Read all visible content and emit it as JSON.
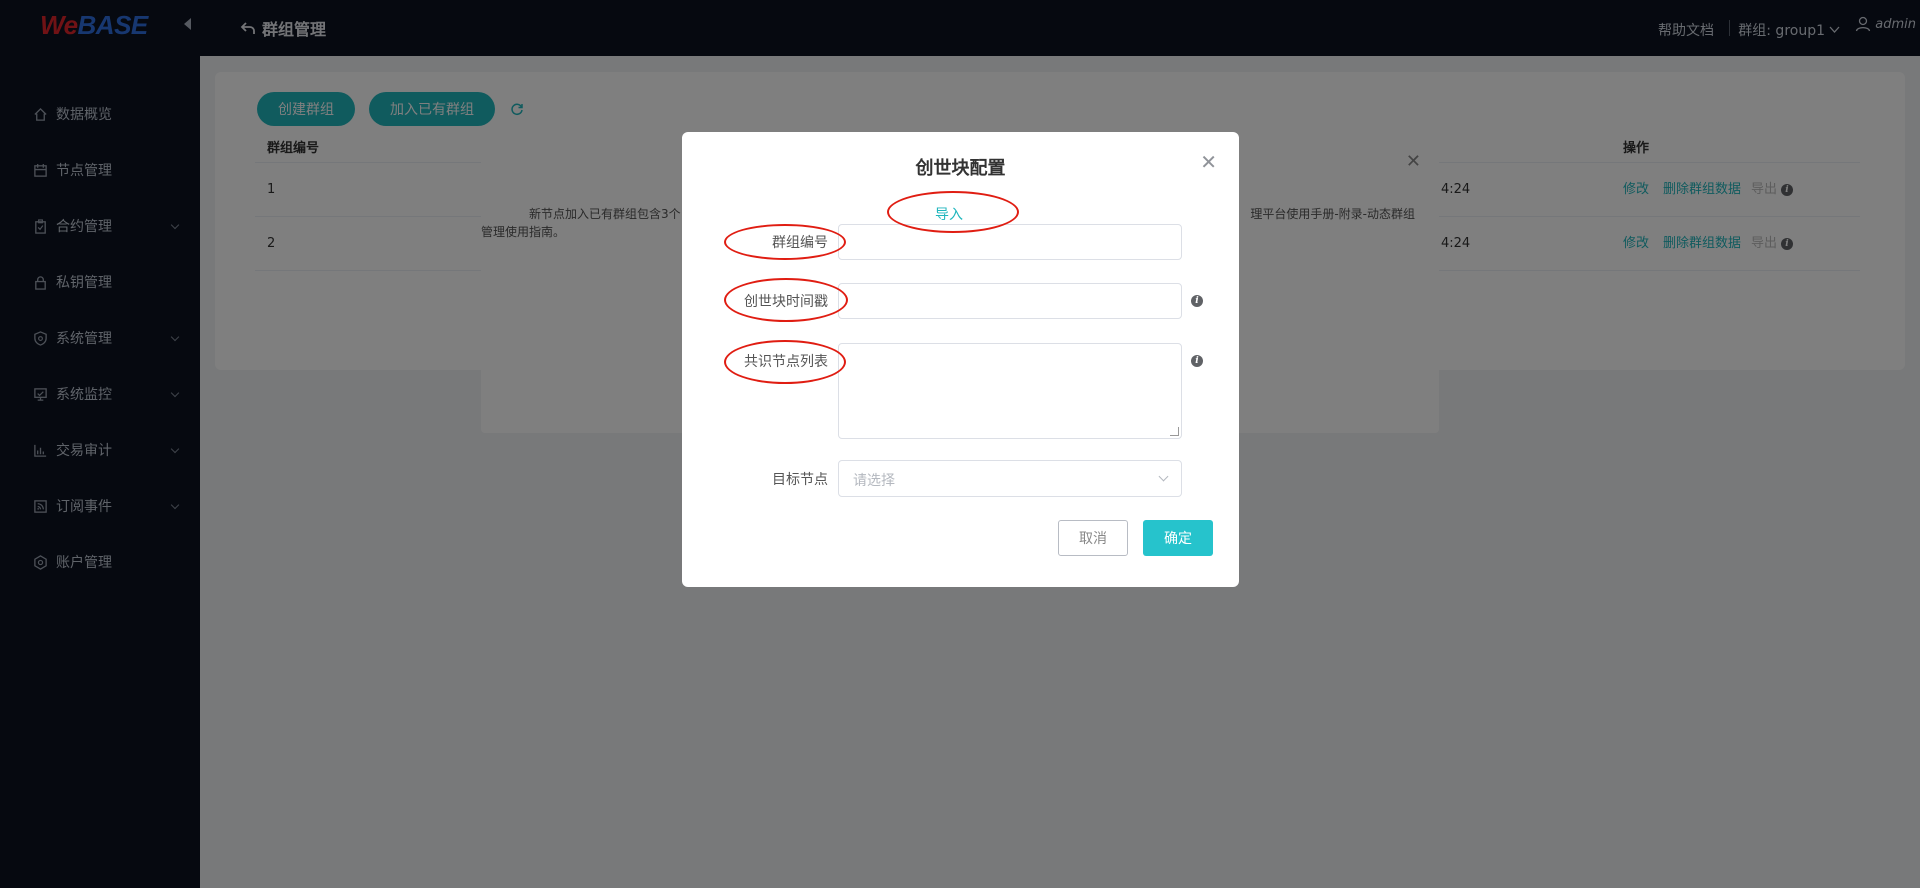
{
  "brand": {
    "logo_we": "We",
    "logo_base": "BASE"
  },
  "header": {
    "page_title": "群组管理",
    "help_docs": "帮助文档",
    "group_selector": "群组: group1",
    "user": "admin"
  },
  "sidebar": {
    "items": [
      {
        "label": "数据概览",
        "icon": "home-icon",
        "expandable": false
      },
      {
        "label": "节点管理",
        "icon": "calendar-icon",
        "expandable": false
      },
      {
        "label": "合约管理",
        "icon": "clipboard-icon",
        "expandable": true
      },
      {
        "label": "私钥管理",
        "icon": "lock-icon",
        "expandable": false
      },
      {
        "label": "系统管理",
        "icon": "shield-icon",
        "expandable": true
      },
      {
        "label": "系统监控",
        "icon": "monitor-icon",
        "expandable": true
      },
      {
        "label": "交易审计",
        "icon": "bar-chart-icon",
        "expandable": true
      },
      {
        "label": "订阅事件",
        "icon": "rss-icon",
        "expandable": true
      },
      {
        "label": "账户管理",
        "icon": "settings-circle-icon",
        "expandable": false
      }
    ]
  },
  "toolbar": {
    "create_group": "创建群组",
    "join_group": "加入已有群组"
  },
  "table": {
    "headers": {
      "group_id": "群组编号",
      "actions": "操作"
    },
    "rows": [
      {
        "id": "1",
        "time_fragment": "4:24",
        "edit": "修改",
        "delete": "删除群组数据",
        "export": "导出"
      },
      {
        "id": "2",
        "time_fragment": "4:24",
        "edit": "修改",
        "delete": "删除群组数据",
        "export": "导出"
      }
    ]
  },
  "back_dialog": {
    "text_left": "新节点加入已有群组包含3个",
    "text_right": "理平台使用手册-附录-动态群组",
    "text_line2": "管理使用指南。"
  },
  "modal": {
    "title": "创世块配置",
    "import": "导入",
    "fields": {
      "group_id": {
        "label": "群组编号",
        "value": ""
      },
      "genesis_timestamp": {
        "label": "创世块时间戳",
        "value": ""
      },
      "consensus_nodes": {
        "label": "共识节点列表",
        "value": ""
      },
      "target_node": {
        "label": "目标节点",
        "placeholder": "请选择"
      }
    },
    "cancel": "取消",
    "confirm": "确定"
  },
  "colors": {
    "accent": "#20b6bd",
    "sidebar_bg": "#0c1220",
    "annotation": "#e01d12"
  }
}
